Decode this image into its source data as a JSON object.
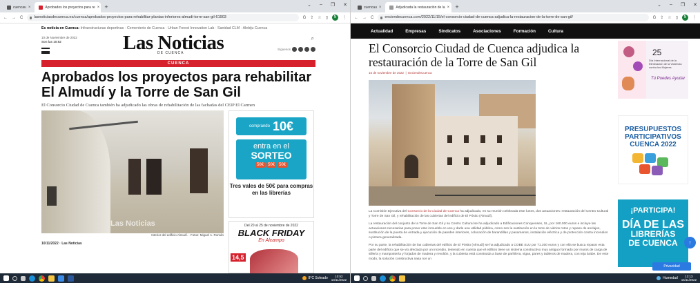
{
  "screen1": {
    "tabs": [
      {
        "label": "cuencau"
      },
      {
        "label": "Aprobados los proyectos para re"
      }
    ],
    "url": "lasnoticiasdecuenca.es/cuenca/aprobados-proyectos-para-rehabilitar-plantas-inferiores-almudi-torre-san-gil-61903",
    "hot_label": "Es noticia en Cuenca:",
    "hot_items": [
      "Infraestructuras deportivas",
      "Cementerio de Cuenca",
      "Urban Forest Innovation Lab",
      "Sanidad CLM",
      "Alebiju Cuenca"
    ],
    "date": "10 de Noviembre de 2022",
    "time": "Son las 10:52",
    "logo": "Las Noticias",
    "logo_sub": "DE CUENCA",
    "follow_label": "Síguenos",
    "band": "CUENCA",
    "headline": "Aprobados los proyectos para rehabilitar El Almudí y la Torre de San Gil",
    "lead": "El Consorcio Ciudad de Cuenca también ha adjudicado las obras de rehabilitación de las fachadas del CEIP El Carmen",
    "photo_watermark": "Las Noticias",
    "photo_caption": "Interior del edificio Almudí. · Fotos: Miguel A. Román",
    "bottom_text": "10/11/2022 · Las Noticias",
    "ad1": {
      "top_word": "comprando",
      "top_amount": "10€",
      "mid_a": "entra en el",
      "mid_b": "SORTEO",
      "chips": [
        "50€",
        "50€",
        "50€"
      ],
      "caption": "Tres vales de 50€ para compras en las librerías"
    },
    "ad2": {
      "dates": "Del 20 al 25 de noviembre de 2022",
      "title": "BLACK FRIDAY",
      "subtitle": "En Alcampo",
      "price": "14,5"
    },
    "taskbar": {
      "weather": "8°C Soleado",
      "time": "10:52",
      "date": "10/11/2022"
    }
  },
  "screen2": {
    "tabs": [
      {
        "label": "cuencau"
      },
      {
        "label": "Adjudicada la restauración de la"
      }
    ],
    "url": "enciendecuenca.com/2022/11/15/el-consorcio-ciudad-de-cuenca-adjudica-la-restauracion-de-la-torre-de-san-gil/",
    "nav": [
      "Actualidad",
      "Empresas",
      "Sindicatos",
      "Asociaciones",
      "Formación",
      "Cultura"
    ],
    "headline": "El Consorcio Ciudad de Cuenca adjudica la restauración de la Torre de San Gil",
    "meta_date": "15 de noviembre de 2022",
    "meta_author": "EnciendeCuenca",
    "para1_link": "Consorcio de la Ciudad de Cuenca",
    "para1_a": "La Comisión Ejecutiva del",
    "para1_b": "ha adjudicado, en su reunión celebrada este lunes, dos actuaciones: restauración del Centro Cultural y Torre de San Gil, y rehabilitación de las cubiertas del edificio de El Pósito (Almudí).",
    "para2": "La restauración del conjunto de la Torre de San Gil y su Centro Cultural se ha adjudicado a Edificaciones Conquenses, SL, por 160.000 euros e incluye las actuaciones necesarias para poner este inmueble en uso y darle una utilidad pública, como son la sustitución en la torre de vidrios rotos y repaso de anclajes, sustitución de la puerta de entrada y ejecución de paredes interiores, colocación de barandillas y pasamanos, instalación eléctrica y de protección contra incendios o pintura generalizada.",
    "para3": "Por su parte, la rehabilitación de las cubiertas del edificio de El Pósito (Almudí) se ha adjudicado a COBE SLU por 71.300 euros y con ella se busca reparar esta parte del edificio que se vio afectada por un incendio, teniendo en cuenta que el edificio tiene un sistema constructivo muy antiguo formado por muros de carga de sillería y mampostería y forjados de madera y revoltón, y la cubierta está construida a base de parhilera, vigas, pares y tableros de madera, con teja árabe. De este modo, la solución constructiva nasa nor un",
    "side": {
      "b1_num": "25",
      "b1_text": "Día Internacional de la Eliminación de la Violencia contra las Mujeres",
      "b1_slogan": "Tú Puedes Ayudar",
      "b2_a": "PRESUPUESTOS",
      "b2_b": "PARTICIPATIVOS",
      "b2_c": "CUENCA 2022",
      "b3_a": "¡PARTICIPA!",
      "b3_b": "DÍA DE LAS",
      "b3_c": "LIBRERÍAS",
      "b3_d": "DE CUENCA"
    },
    "fab_icon": "arrow-up",
    "privacy": "Privacidad",
    "taskbar": {
      "weather": "Humedad",
      "time": "13:13",
      "date": "15/11/2022"
    }
  }
}
